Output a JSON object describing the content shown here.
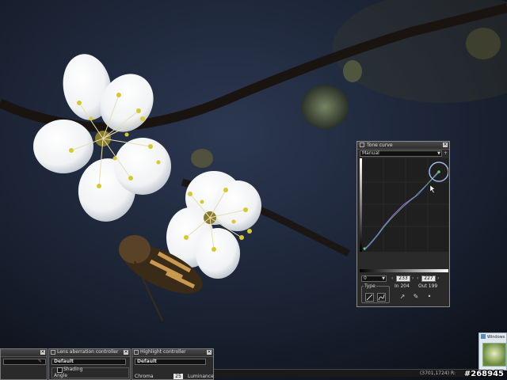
{
  "tone_curve_panel": {
    "title": "Tone curve",
    "mode": "Manual",
    "channel": "0",
    "input_value": "233",
    "output_value": "227",
    "in_label": "In 204",
    "out_label": "Out 199",
    "type_label": "Type"
  },
  "bottom_panels": {
    "panel_a": {
      "select": ""
    },
    "lens_panel": {
      "title": "Lens aberration controller",
      "select": "Default",
      "checkbox_label": "Shading",
      "row_label": "Angle"
    },
    "highlight_panel": {
      "title": "Highlight controller",
      "select": "Default",
      "chroma_label": "Chroma",
      "chroma_value": "25",
      "luminance_label": "Luminance"
    }
  },
  "status_bar": {
    "coords": "(3701,1724) R:"
  },
  "taskbar_thumb": {
    "label": "Windows"
  },
  "watermark": "#268945",
  "colors": {
    "panel_bg": "#2a2a2a",
    "highlight_ring": "#9ab8e8"
  }
}
